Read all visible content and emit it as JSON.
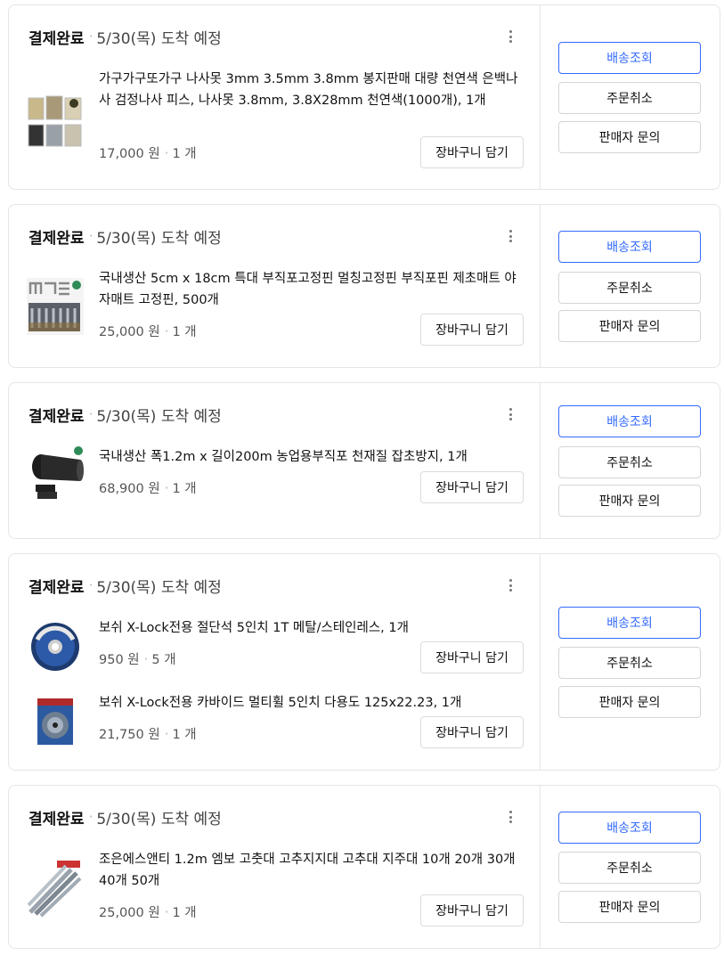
{
  "orders": [
    {
      "status": "결제완료",
      "arrival": "5/30(목) 도착 예정",
      "items": [
        {
          "name": "가구가구또가구 나사못 3mm 3.5mm 3.8mm 봉지판매 대량 천연색 은백나사 검정나사 피스, 나사못 3.8mm, 3.8X28mm 천연색(1000개), 1개",
          "price": "17,000 원",
          "qty": "1 개",
          "cart_label": "장바구니 담기"
        }
      ],
      "actions": {
        "track": "배송조회",
        "cancel": "주문취소",
        "inquiry": "판매자 문의"
      }
    },
    {
      "status": "결제완료",
      "arrival": "5/30(목) 도착 예정",
      "items": [
        {
          "name": "국내생산 5cm x 18cm 특대 부직포고정핀 멀칭고정핀 부직포핀 제초매트 야자매트 고정핀, 500개",
          "price": "25,000 원",
          "qty": "1 개",
          "cart_label": "장바구니 담기"
        }
      ],
      "actions": {
        "track": "배송조회",
        "cancel": "주문취소",
        "inquiry": "판매자 문의"
      }
    },
    {
      "status": "결제완료",
      "arrival": "5/30(목) 도착 예정",
      "items": [
        {
          "name": "국내생산 폭1.2m x 길이200m 농업용부직포 천재질 잡초방지, 1개",
          "price": "68,900 원",
          "qty": "1 개",
          "cart_label": "장바구니 담기"
        }
      ],
      "actions": {
        "track": "배송조회",
        "cancel": "주문취소",
        "inquiry": "판매자 문의"
      }
    },
    {
      "status": "결제완료",
      "arrival": "5/30(목) 도착 예정",
      "items": [
        {
          "name": "보쉬 X-Lock전용 절단석 5인치 1T 메탈/스테인레스, 1개",
          "price": "950 원",
          "qty": "5 개",
          "cart_label": "장바구니 담기"
        },
        {
          "name": "보쉬 X-Lock전용 카바이드 멀티휠 5인치 다용도 125x22.23, 1개",
          "price": "21,750 원",
          "qty": "1 개",
          "cart_label": "장바구니 담기"
        }
      ],
      "actions": {
        "track": "배송조회",
        "cancel": "주문취소",
        "inquiry": "판매자 문의"
      }
    },
    {
      "status": "결제완료",
      "arrival": "5/30(목) 도착 예정",
      "items": [
        {
          "name": "조은에스앤티 1.2m 엠보 고춧대 고추지지대 고추대 지주대 10개 20개 30개 40개 50개",
          "price": "25,000 원",
          "qty": "1 개",
          "cart_label": "장바구니 담기"
        }
      ],
      "actions": {
        "track": "배송조회",
        "cancel": "주문취소",
        "inquiry": "판매자 문의"
      }
    }
  ],
  "colors": {
    "primary": "#346aff",
    "border": "#e3e5e8"
  }
}
